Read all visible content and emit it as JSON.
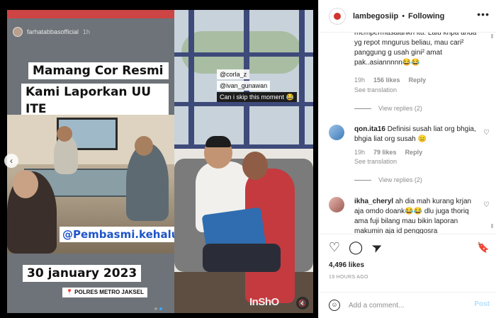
{
  "media": {
    "story_username": "farhatabbasofficial",
    "story_time": "1h",
    "caption_line1": "Mamang Cor Resmi",
    "caption_line2": "Kami Laporkan UU ITE",
    "handle_tag": "@Pembasmi.kehaluan.reall",
    "date": "30 january 2023",
    "location": "📍 POLRES METRO JAKSEL",
    "overlay_tag1": "@corla_z",
    "overlay_tag2": "@ivan_gunawan",
    "overlay_sub": "Can i skip this moment 😂",
    "watermark": "InShO",
    "prev_icon": "‹",
    "mute_icon": "🔇"
  },
  "post": {
    "username": "lambegosiip",
    "separator": "•",
    "follow_label": "Following",
    "more_icon": "•••"
  },
  "comments": [
    {
      "text": "mempermasalahkn itu. Lalu knpa anda yg repot mngurus beliau, mau cari² panggung g usah gini² amat pak..asiannnnn😂😂",
      "time": "19h",
      "likes": "156 likes",
      "reply": "Reply",
      "see_translation": "See translation",
      "view_replies": "View replies (2)"
    },
    {
      "user": "qon.ita16",
      "text": "Definisi susah liat org bhgia, bhgia liat org susah 😑",
      "time": "19h",
      "likes": "79 likes",
      "reply": "Reply",
      "see_translation": "See translation",
      "view_replies": "View replies (2)"
    },
    {
      "user": "ikha_cheryl",
      "text": "ah dia mah kurang krjan aja omdo doank😂😂 dlu juga thoriq ama fuji bilang mau bikin laporan makumin aja id penggosra"
    }
  ],
  "actions": {
    "like_icon": "♡",
    "comment_icon": "◯",
    "share_icon": "➤",
    "save_icon": "🔖",
    "heart_small": "♡"
  },
  "likes_count": "4,496 likes",
  "posted_time": "19 HOURS AGO",
  "comment_box": {
    "emoji_icon": "☺",
    "placeholder": "Add a comment...",
    "post_label": "Post"
  }
}
